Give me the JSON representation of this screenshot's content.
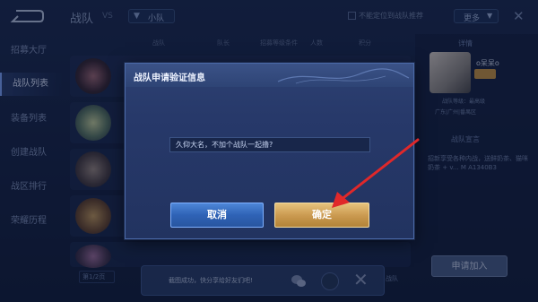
{
  "header": {
    "title": "战队",
    "title_sub": "VS",
    "scope_label": "小队",
    "filter_label": "不能定位到战队推荐",
    "more_label": "更多",
    "more_arrow": "▼"
  },
  "sidebar": {
    "items": [
      {
        "label": "招募大厅"
      },
      {
        "label": "战队列表"
      },
      {
        "label": "装备列表"
      },
      {
        "label": "创建战队"
      },
      {
        "label": "战区排行"
      },
      {
        "label": "荣耀历程"
      }
    ]
  },
  "table_columns": [
    "战队",
    "队长",
    "招募等级条件",
    "人数",
    "积分"
  ],
  "right_panel": {
    "title": "详情",
    "nickname": "o呆呆o",
    "rank_badge": "",
    "info_line1": "战队等级：最高级",
    "info_line2": "广东|广州|番禺区",
    "declaration_title": "战队宣言",
    "declaration_text": "招新享受各种内战，送鲜奶茶、猫咪奶茶 + v... M A1340B3"
  },
  "apply_button": "申请加入",
  "page_select": "第1/2页",
  "bottom_right_text": "战队",
  "share": {
    "text": "截图成功，快分享给好友们吧!"
  },
  "dialog": {
    "title": "战队申请验证信息",
    "input_value": "久仰大名，不加个战队一起撸?",
    "cancel_label": "取消",
    "confirm_label": "确定"
  },
  "colors": {
    "cancel": "#2f63b6",
    "confirm": "#c9984e",
    "annotation_arrow": "#e0282a"
  }
}
